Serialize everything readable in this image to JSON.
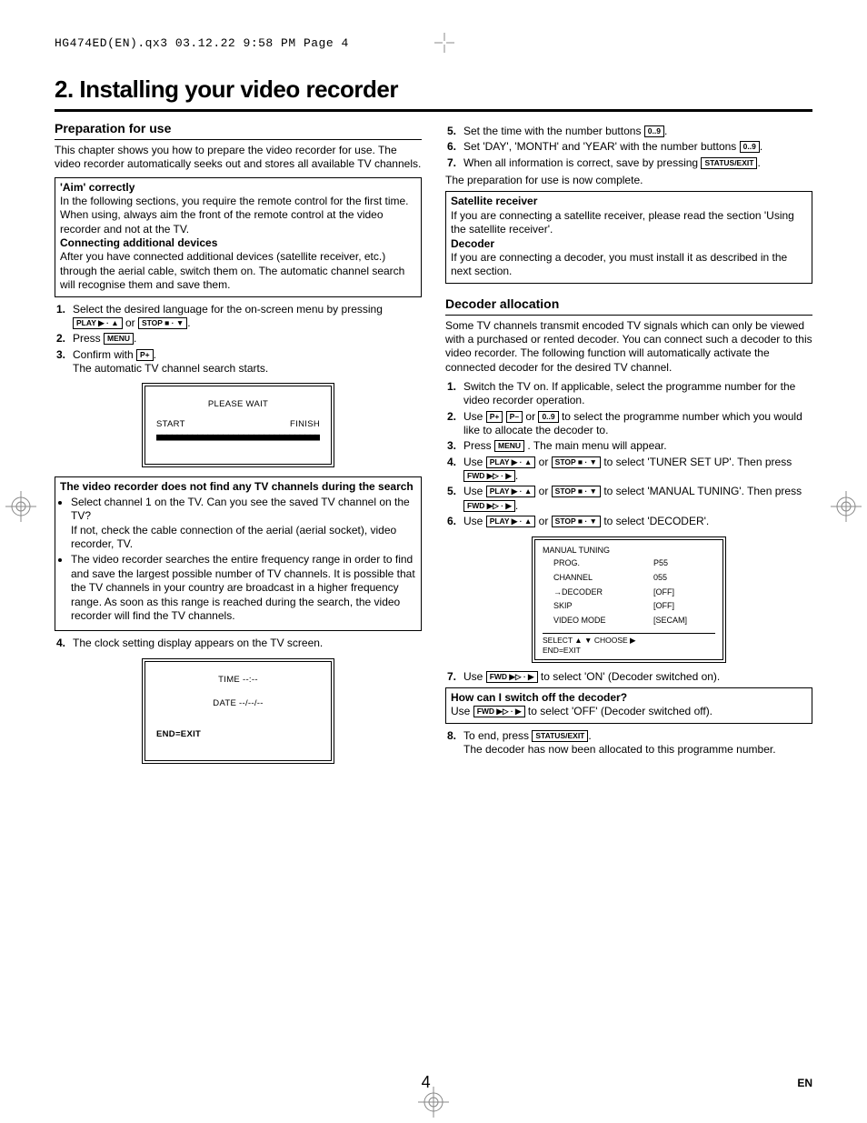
{
  "meta": {
    "header": "HG474ED(EN).qx3  03.12.22  9:58 PM  Page 4"
  },
  "title": "2. Installing your video recorder",
  "left": {
    "h2": "Preparation for use",
    "intro": "This chapter shows you how to prepare the video recorder for use. The video recorder automatically seeks out and stores all available TV channels.",
    "aim_h": "'Aim' correctly",
    "aim_t": "In the following sections, you require the remote control for the first time. When using, always aim the front of the remote control at the video recorder and not at the TV.",
    "conn_h": "Connecting additional devices",
    "conn_t": "After you have connected additional devices (satellite receiver, etc.) through the aerial cable, switch them on. The automatic channel search will recognise them and save them.",
    "s1a": "Select the desired language for the on-screen menu by pressing ",
    "or": " or ",
    "s2a": "Press ",
    "s3a": "Confirm with ",
    "s3b": "The automatic TV channel search starts.",
    "scr1_wait": "PLEASE WAIT",
    "scr1_start": "START",
    "scr1_finish": "FINISH",
    "scr1_bar": "■■■■■■■■■■■■■■■■■■■■■■■■■■■■■■■■",
    "trouble_h": "The video recorder does not find any TV channels during the search",
    "b1a": "Select channel 1 on the TV. Can you see the saved TV channel on the TV?",
    "b1b": "If not, check the cable connection of the aerial (aerial socket), video recorder, TV.",
    "b2": "The video recorder searches the entire frequency range in order to find and save the largest possible number of TV channels. It is possible that the TV channels in your country are broadcast in a higher frequency range. As soon as this range is reached during the search, the video recorder will find the TV channels.",
    "s4": "The clock setting display appears on the TV screen.",
    "scr2_time": "TIME --:--",
    "scr2_date": "DATE --/--/--",
    "scr2_end": "END=EXIT"
  },
  "right": {
    "s5a": "Set the time with the number buttons ",
    "s6a": "Set 'DAY', 'MONTH' and 'YEAR' with the number buttons ",
    "s7a": "When all information is correct, save by pressing ",
    "prep_done": "The preparation for use is now complete.",
    "sat_h": "Satellite receiver",
    "sat_t": "If you are connecting a satellite receiver, please read the section 'Using the satellite receiver'.",
    "dec_h": "Decoder",
    "dec_t": "If you are connecting a decoder, you must install it as described in the next section.",
    "h2": "Decoder allocation",
    "intro": "Some TV channels transmit encoded TV signals which can only be viewed with a purchased or rented decoder. You can connect such a decoder to this video recorder. The following function will automatically activate the connected decoder for the desired TV channel.",
    "d1": "Switch the TV on. If applicable, select the programme number for the video recorder operation.",
    "d2a": "Use ",
    "d2b": " to select the programme number which you would like to allocate the decoder to.",
    "d3a": "Press ",
    "d3b": ". The main menu will appear.",
    "d4a": "Use ",
    "d4b": " to select 'TUNER SET UP'. Then press ",
    "d5a": "Use ",
    "d5b": " to select 'MANUAL TUNING'. Then press ",
    "d6a": "Use ",
    "d6b": " to select 'DECODER'.",
    "osd_title": "MANUAL TUNING",
    "osd": {
      "r1a": "PROG.",
      "r1b": "P55",
      "r2a": "CHANNEL",
      "r2b": "055",
      "r3a": "→DECODER",
      "r3b": "[OFF]",
      "r4a": "SKIP",
      "r4b": "[OFF]",
      "r5a": "VIDEO MODE",
      "r5b": "[SECAM]"
    },
    "osd_foot": "SELECT ▲ ▼   CHOOSE ▶\nEND=EXIT",
    "d7a": "Use ",
    "d7b": " to select 'ON' (Decoder switched on).",
    "off_h": "How can I switch off the decoder?",
    "off_a": "Use ",
    "off_b": " to select 'OFF' (Decoder switched off).",
    "d8a": "To end, press ",
    "d8b": "The decoder has now been allocated to this programme number."
  },
  "buttons": {
    "play": "PLAY ▶ · ▲",
    "stop": "STOP ■ · ▼",
    "menu": "MENU",
    "pplus": "P+",
    "pminus": "P–",
    "num": "0..9",
    "status": "STATUS/EXIT",
    "fwd": "FWD ▶▷ · ▶"
  },
  "footer": {
    "page": "4",
    "lang": "EN"
  }
}
